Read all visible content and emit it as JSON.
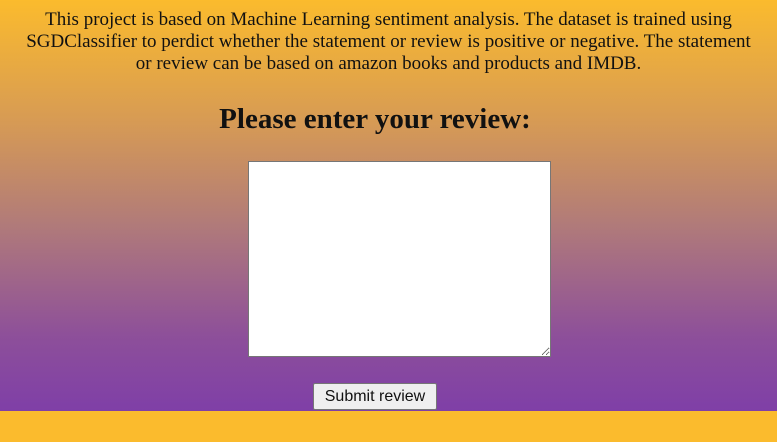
{
  "main": {
    "description": "This project is based on Machine Learning sentiment analysis. The dataset is trained using SGDClassifier to perdict whether the statement or review is positive or negative. The statement or review can be based on amazon books and products and IMDB.",
    "heading": "Please enter your review:",
    "review_input": {
      "value": "",
      "placeholder": ""
    },
    "submit_label": "Submit review"
  },
  "colors": {
    "gradient_top": "#fbbb2d",
    "gradient_bottom": "#7f3fa7",
    "footer_band": "#fbbb2d"
  }
}
